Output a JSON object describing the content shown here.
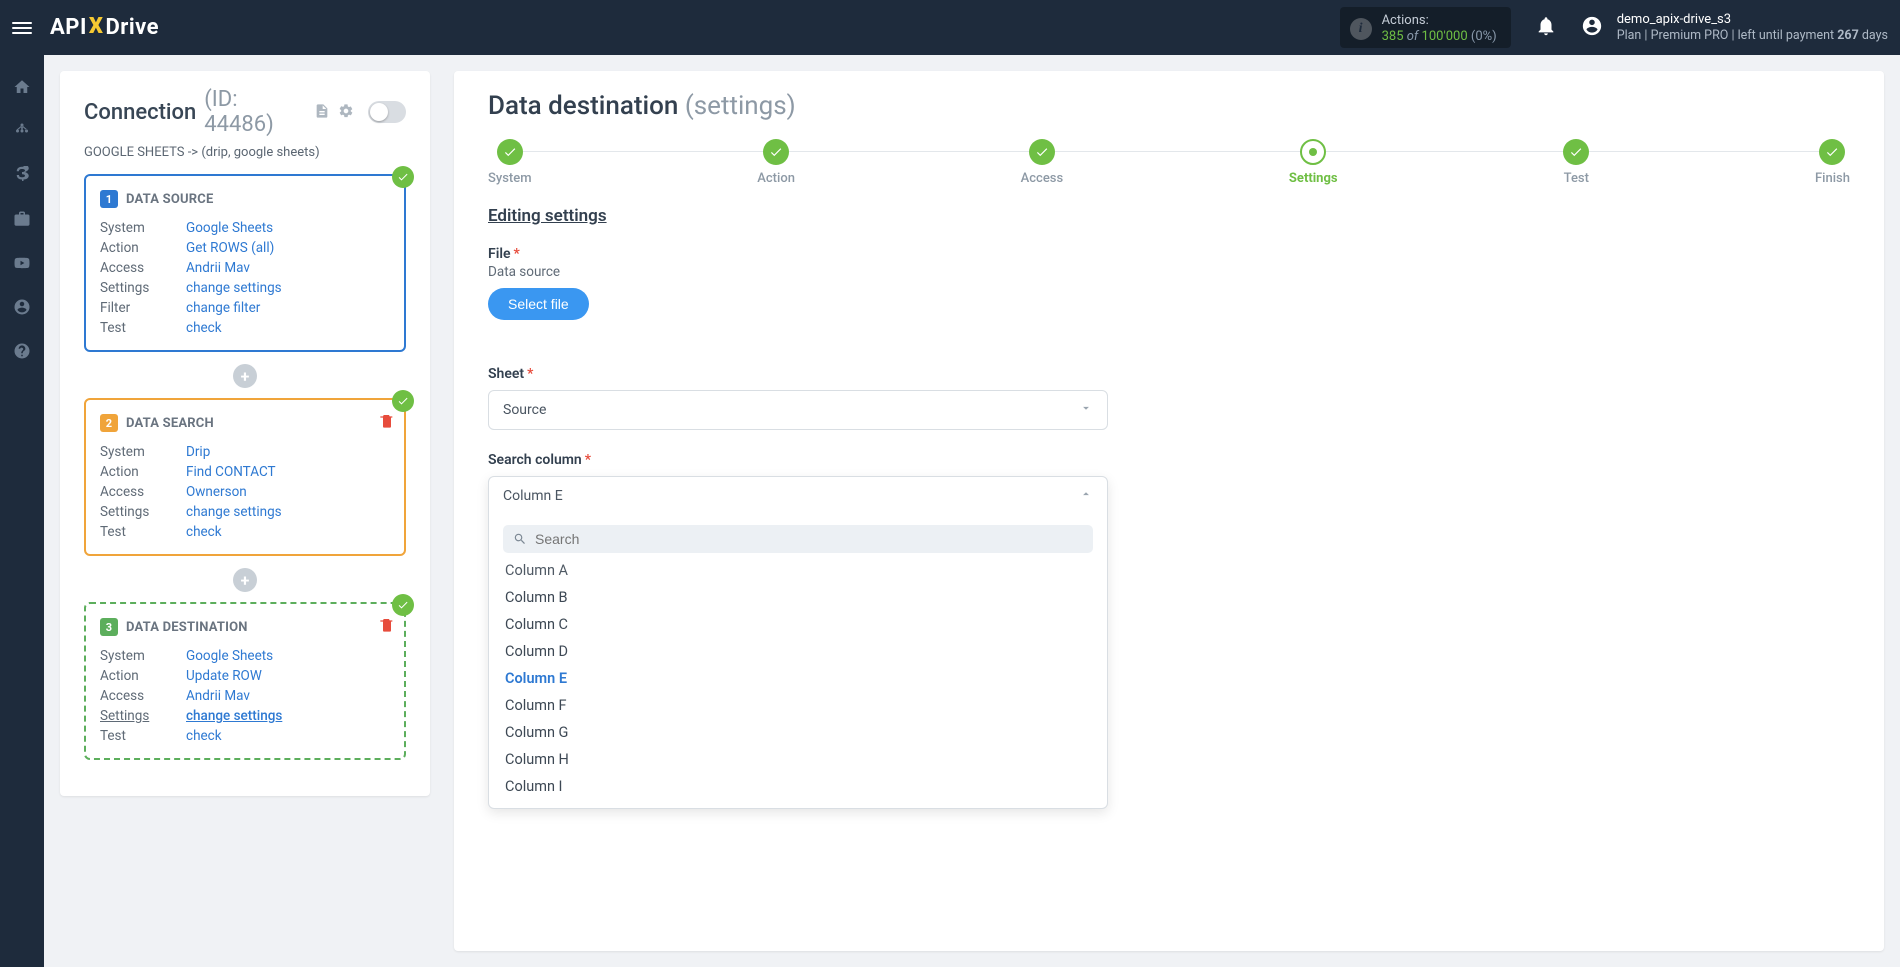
{
  "header": {
    "logo_api": "API",
    "logo_drive": "Drive",
    "actions_label": "Actions:",
    "actions_used": "385",
    "actions_of": "of",
    "actions_total": "100'000",
    "actions_pct": "(0%)",
    "username": "demo_apix-drive_s3",
    "plan_prefix": "Plan |",
    "plan_name": "Premium PRO",
    "plan_mid": "| left until payment",
    "plan_days": "267",
    "plan_days_suffix": "days"
  },
  "leftPanel": {
    "title": "Connection",
    "id_part": "(ID: 44486)",
    "subtitle": "GOOGLE SHEETS -> (drip, google sheets)",
    "cards": [
      {
        "num": "1",
        "title": "DATA SOURCE",
        "rows": {
          "System": "Google Sheets",
          "Action": "Get ROWS (all)",
          "Access": "Andrii Mav",
          "Settings": "change settings",
          "Filter": "change filter",
          "Test": "check"
        }
      },
      {
        "num": "2",
        "title": "DATA SEARCH",
        "rows": {
          "System": "Drip",
          "Action": "Find CONTACT",
          "Access": "Ownerson",
          "Settings": "change settings",
          "Test": "check"
        }
      },
      {
        "num": "3",
        "title": "DATA DESTINATION",
        "rows": {
          "System": "Google Sheets",
          "Action": "Update ROW",
          "Access": "Andrii Mav",
          "Settings": "change settings",
          "Test": "check"
        }
      }
    ]
  },
  "rightPanel": {
    "title": "Data destination",
    "title_sub": "(settings)",
    "steps": [
      "System",
      "Action",
      "Access",
      "Settings",
      "Test",
      "Finish"
    ],
    "current_step": "Settings",
    "section_head": "Editing settings",
    "file_label": "File",
    "file_hint": "Data source",
    "select_file_btn": "Select file",
    "sheet_label": "Sheet",
    "sheet_value": "Source",
    "search_col_label": "Search column",
    "search_col_value": "Column E",
    "search_placeholder": "Search",
    "options": [
      "Column A",
      "Column B",
      "Column C",
      "Column D",
      "Column E",
      "Column F",
      "Column G",
      "Column H",
      "Column I"
    ],
    "selected_option": "Column E"
  }
}
